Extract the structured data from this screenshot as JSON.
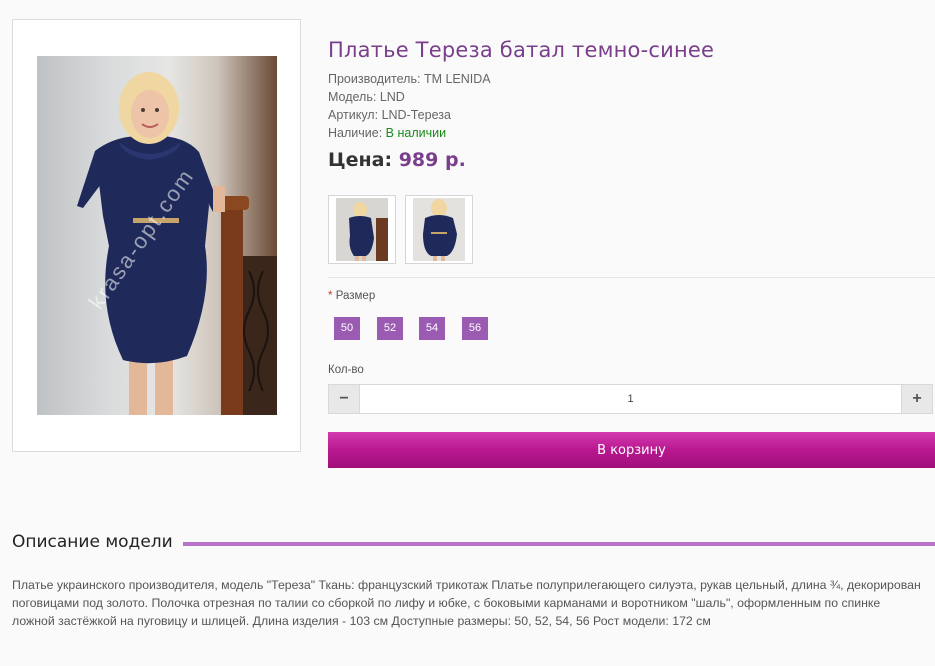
{
  "product": {
    "title": "Платье Тереза батал темно-синее",
    "manufacturer_label": "Производитель:",
    "manufacturer_value": "TM LENIDA",
    "model_label": "Модель:",
    "model_value": "LND",
    "sku_label": "Артикул:",
    "sku_value": "LND-Тереза",
    "availability_label": "Наличие:",
    "availability_value": "В наличии",
    "price_label": "Цена:",
    "price_value": "989 р.",
    "watermark": "krasa-opt.com"
  },
  "options": {
    "size_required_mark": "*",
    "size_label": "Размер",
    "sizes": [
      "50",
      "52",
      "54",
      "56"
    ]
  },
  "quantity": {
    "label": "Кол-во",
    "minus": "−",
    "value": "1",
    "plus": "+"
  },
  "cart": {
    "button_label": "В корзину"
  },
  "description": {
    "heading": "Описание модели",
    "text": "Платье украинского производителя, модель \"Тереза\" Ткань: французский трикотаж Платье полуприлегающего силуэта, рукав цельный, длина ¾, декорирован поговицами под золото. Полочка отрезная по талии со сборкой по лифу и юбке, с боковыми карманами и воротником \"шаль\", оформленным по спинке ложной застёжкой на пуговицу и шлицей. Длина изделия - 103 см Доступные размеры: 50, 52, 54, 56 Рост модели: 172 см"
  },
  "colors": {
    "accent": "#7a3f8c",
    "size_bg": "#9c5bb3",
    "cart_button": "#b8188f",
    "in_stock": "#1a8a1a",
    "dress": "#1f2a5a"
  }
}
